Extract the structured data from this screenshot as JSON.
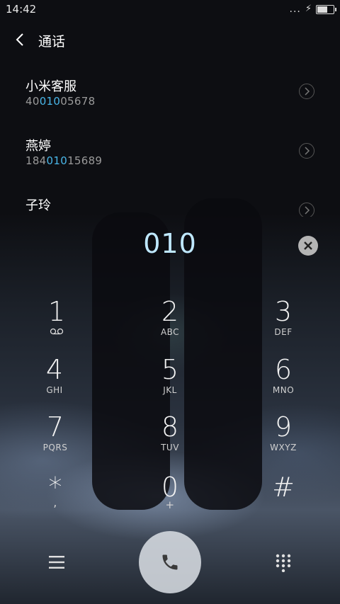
{
  "status": {
    "time": "14:42",
    "signal": "...",
    "charging": "⚡"
  },
  "header": {
    "title": "通话"
  },
  "contacts": [
    {
      "name": "小米客服",
      "number_pre": "40",
      "number_match": "010",
      "number_post": "05678"
    },
    {
      "name": "燕婷",
      "number_pre": "184",
      "number_match": "010",
      "number_post": "15689"
    },
    {
      "name": "子玲"
    }
  ],
  "dial": {
    "entered": "010"
  },
  "keypad": [
    {
      "digit": "1",
      "letters": ""
    },
    {
      "digit": "2",
      "letters": "ABC"
    },
    {
      "digit": "3",
      "letters": "DEF"
    },
    {
      "digit": "4",
      "letters": "GHI"
    },
    {
      "digit": "5",
      "letters": "JKL"
    },
    {
      "digit": "6",
      "letters": "MNO"
    },
    {
      "digit": "7",
      "letters": "PQRS"
    },
    {
      "digit": "8",
      "letters": "TUV"
    },
    {
      "digit": "9",
      "letters": "WXYZ"
    },
    {
      "digit": "*",
      "letters": ","
    },
    {
      "digit": "0",
      "letters": "+"
    },
    {
      "digit": "#",
      "letters": ""
    }
  ],
  "icons": {
    "back": "chevron-left-icon",
    "voicemail": "voicemail-icon",
    "clear": "close-circle-icon",
    "menu": "menu-icon",
    "call": "phone-icon",
    "keypad_toggle": "dialpad-icon"
  },
  "colors": {
    "match_highlight": "#49b6e8",
    "dial_text": "#bfe8ff"
  }
}
